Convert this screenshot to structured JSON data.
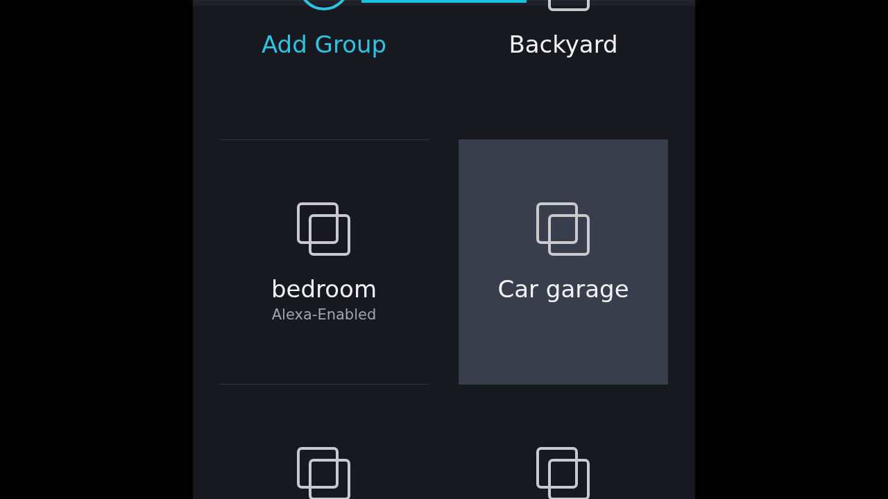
{
  "tab_bar": {
    "tabs": [
      {
        "selected": false
      },
      {
        "selected": true
      },
      {
        "selected": false
      }
    ]
  },
  "tiles": [
    {
      "kind": "add",
      "name": "Add Group",
      "selected": false
    },
    {
      "kind": "group",
      "name": "Backyard",
      "selected": false
    },
    {
      "kind": "group",
      "name": "bedroom",
      "subtitle": "Alexa-Enabled",
      "selected": false
    },
    {
      "kind": "group",
      "name": "Car garage",
      "selected": true
    },
    {
      "kind": "group",
      "selected": false
    },
    {
      "kind": "group",
      "selected": false
    }
  ]
}
